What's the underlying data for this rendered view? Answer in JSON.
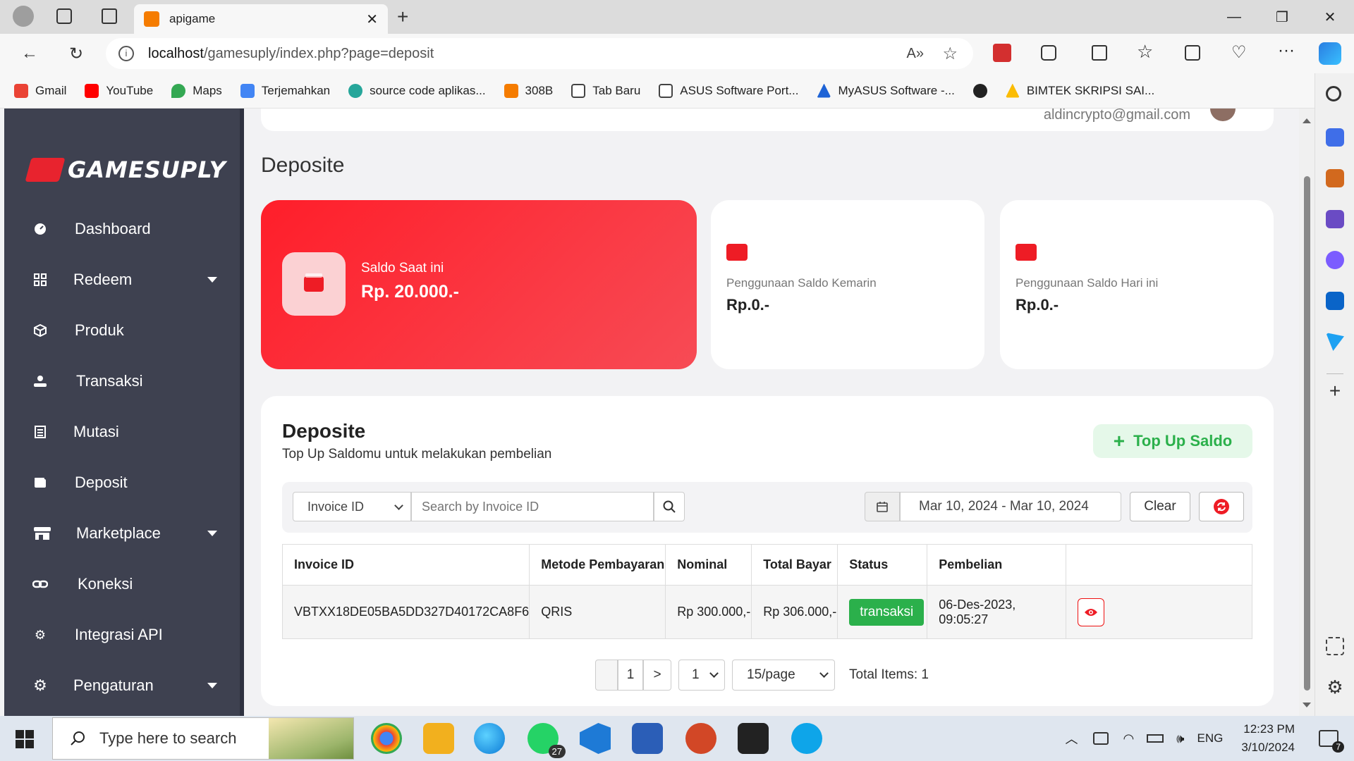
{
  "browser": {
    "tab_title": "apigame",
    "url_host": "localhost",
    "url_path": "/gamesuply/index.php?page=deposit",
    "bookmarks": [
      {
        "label": "Gmail",
        "color": "#ea4335"
      },
      {
        "label": "YouTube",
        "color": "#ff0000"
      },
      {
        "label": "Maps",
        "color": "#34a853"
      },
      {
        "label": "Terjemahkan",
        "color": "#4285f4"
      },
      {
        "label": "source code aplikas...",
        "color": "#26a69a"
      },
      {
        "label": "308B",
        "color": "#f57c00"
      },
      {
        "label": "Tab Baru",
        "color": "#9e9e9e"
      },
      {
        "label": "ASUS Software Port...",
        "color": "#9e9e9e"
      },
      {
        "label": "MyASUS Software -...",
        "color": "#1e63d6"
      },
      {
        "label": "",
        "color": "#222222"
      },
      {
        "label": "BIMTEK SKRIPSI SAI...",
        "color": "#fbbc04"
      }
    ]
  },
  "sidebar": {
    "brand": "GAMESUPLY",
    "items": [
      {
        "label": "Dashboard",
        "icon": "dashboard-icon"
      },
      {
        "label": "Redeem",
        "icon": "grid-icon"
      },
      {
        "label": "Produk",
        "icon": "box-icon"
      },
      {
        "label": "Transaksi",
        "icon": "hand-coin-icon"
      },
      {
        "label": "Mutasi",
        "icon": "list-icon"
      },
      {
        "label": "Deposit",
        "icon": "wallet-icon"
      },
      {
        "label": "Marketplace",
        "icon": "store-icon"
      },
      {
        "label": "Koneksi",
        "icon": "link-icon"
      },
      {
        "label": "Integrasi API",
        "icon": "gear-icon"
      },
      {
        "label": "Pengaturan",
        "icon": "settings-icon"
      }
    ]
  },
  "header": {
    "email": "aldincrypto@gmail.com",
    "page_title": "Deposite"
  },
  "cards": {
    "saldo_label": "Saldo Saat ini",
    "saldo_value": "Rp. 20.000.-",
    "kemarin_label": "Penggunaan Saldo Kemarin",
    "kemarin_value": "Rp.0.-",
    "hariini_label": "Penggunaan Saldo Hari ini",
    "hariini_value": "Rp.0.-"
  },
  "deposit": {
    "title": "Deposite",
    "subtitle": "Top Up Saldomu untuk melakukan pembelian",
    "topup_label": "Top Up Saldo",
    "filter_select": "Invoice ID",
    "search_placeholder": "Search by Invoice ID",
    "date_range": "Mar 10, 2024 - Mar 10, 2024",
    "clear_label": "Clear",
    "columns": [
      "Invoice ID",
      "Metode Pembayaran",
      "Nominal",
      "Total Bayar",
      "Status",
      "Pembelian"
    ],
    "rows": [
      {
        "invoice": "VBTXX18DE05BA5DD327D40172CA8F6",
        "metode": "QRIS",
        "nominal": "Rp 300.000,-",
        "total": "Rp 306.000,-",
        "status": "transaksi",
        "pembelian": "06-Des-2023, 09:05:27"
      }
    ],
    "pager": {
      "page": "1",
      "next": ">",
      "page_select": "1",
      "per_page": "15/page",
      "total": "Total Items: 1"
    }
  },
  "taskbar": {
    "search_placeholder": "Type here to search",
    "whatsapp_badge": "27",
    "lang": "ENG",
    "time": "12:23 PM",
    "date": "3/10/2024",
    "notif_count": "7"
  }
}
